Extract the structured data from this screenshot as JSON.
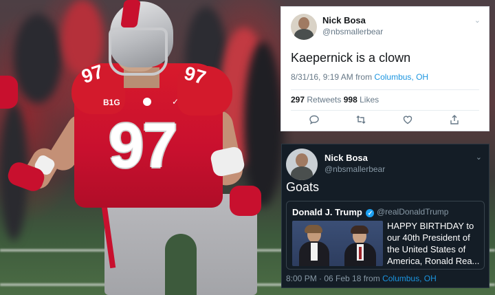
{
  "tweet1": {
    "name": "Nick Bosa",
    "handle": "@nbsmallerbear",
    "text": "Kaepernick is a clown",
    "time": "8/31/16, 9:19 AM from ",
    "location": "Columbus, OH",
    "retweets_count": "297",
    "retweets_label": " Retweets ",
    "likes_count": "998",
    "likes_label": " Likes",
    "actions": [
      "reply-icon",
      "retweet-icon",
      "like-icon",
      "share-icon"
    ]
  },
  "tweet2": {
    "name": "Nick Bosa",
    "handle": "@nbsmallerbear",
    "text": "Goats",
    "quote": {
      "name": "Donald J. Trump",
      "handle": "@realDonaldTrump",
      "text": "HAPPY BIRTHDAY to our 40th President of the United States of America, Ronald Rea..."
    },
    "time": "8:00 PM · 06 Feb 18 from ",
    "location": "Columbus, OH"
  },
  "photo": {
    "jersey_number": "97",
    "conference_logo": "B1G"
  },
  "colors": {
    "link": "#1b95e0",
    "jersey_red": "#c8102e",
    "dark_card": "#141d26"
  }
}
